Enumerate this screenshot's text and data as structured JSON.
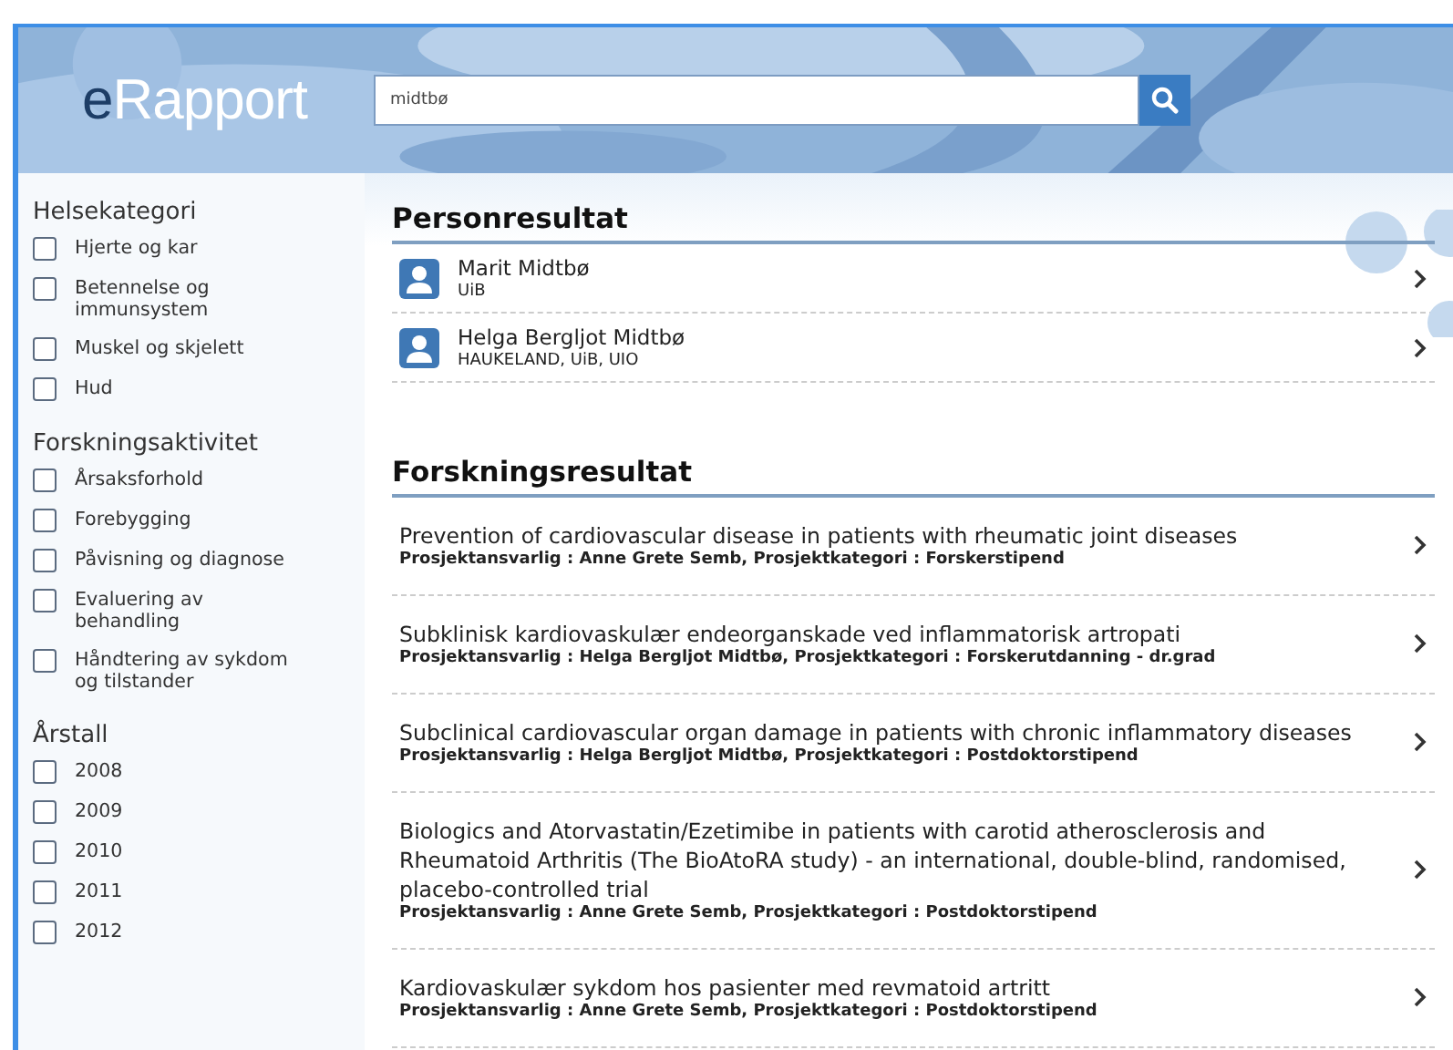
{
  "header": {
    "logo_prefix": "e",
    "logo_rest": "Rapport",
    "search": {
      "value": "midtbø"
    }
  },
  "sidebar": [
    {
      "heading": "Helsekategori",
      "items": [
        {
          "label": "Hjerte og kar",
          "checked": false
        },
        {
          "label": "Betennelse og immunsystem",
          "checked": false
        },
        {
          "label": "Muskel og skjelett",
          "checked": false
        },
        {
          "label": "Hud",
          "checked": false
        }
      ]
    },
    {
      "heading": "Forskningsaktivitet",
      "items": [
        {
          "label": "Årsaksforhold",
          "checked": false
        },
        {
          "label": "Forebygging",
          "checked": false
        },
        {
          "label": "Påvisning og diagnose",
          "checked": false
        },
        {
          "label": "Evaluering av behandling",
          "checked": false
        },
        {
          "label": "Håndtering av sykdom og tilstander",
          "checked": false
        }
      ]
    },
    {
      "heading": "Årstall",
      "items": [
        {
          "label": "2008",
          "checked": false
        },
        {
          "label": "2009",
          "checked": false
        },
        {
          "label": "2010",
          "checked": false
        },
        {
          "label": "2011",
          "checked": false
        },
        {
          "label": "2012",
          "checked": false
        }
      ]
    }
  ],
  "person_results": {
    "heading": "Personresultat",
    "items": [
      {
        "name": "Marit Midtbø",
        "affiliation": "UiB"
      },
      {
        "name": "Helga Bergljot Midtbø",
        "affiliation": "HAUKELAND, UiB, UIO"
      }
    ]
  },
  "research_results": {
    "heading": "Forskningsresultat",
    "items": [
      {
        "title": "Prevention of cardiovascular disease in patients with rheumatic joint diseases",
        "meta": "Prosjektansvarlig : Anne Grete Semb, Prosjektkategori : Forskerstipend"
      },
      {
        "title": "Subklinisk kardiovaskulær endeorganskade ved inflammatorisk artropati",
        "meta": "Prosjektansvarlig : Helga Bergljot Midtbø, Prosjektkategori : Forskerutdanning - dr.grad"
      },
      {
        "title": "Subclinical cardiovascular organ damage in patients with chronic inflammatory diseases",
        "meta": "Prosjektansvarlig : Helga Bergljot Midtbø, Prosjektkategori : Postdoktorstipend"
      },
      {
        "title": "Biologics and Atorvastatin/Ezetimibe in patients with carotid atherosclerosis and Rheumatoid Arthritis (The BioAtoRA study) - an international, double-blind, randomised, placebo-controlled trial",
        "meta": "Prosjektansvarlig : Anne Grete Semb, Prosjektkategori : Postdoktorstipend"
      },
      {
        "title": "Kardiovaskulær sykdom hos pasienter med revmatoid artritt",
        "meta": "Prosjektansvarlig : Anne Grete Semb, Prosjektkategori : Postdoktorstipend"
      }
    ]
  }
}
